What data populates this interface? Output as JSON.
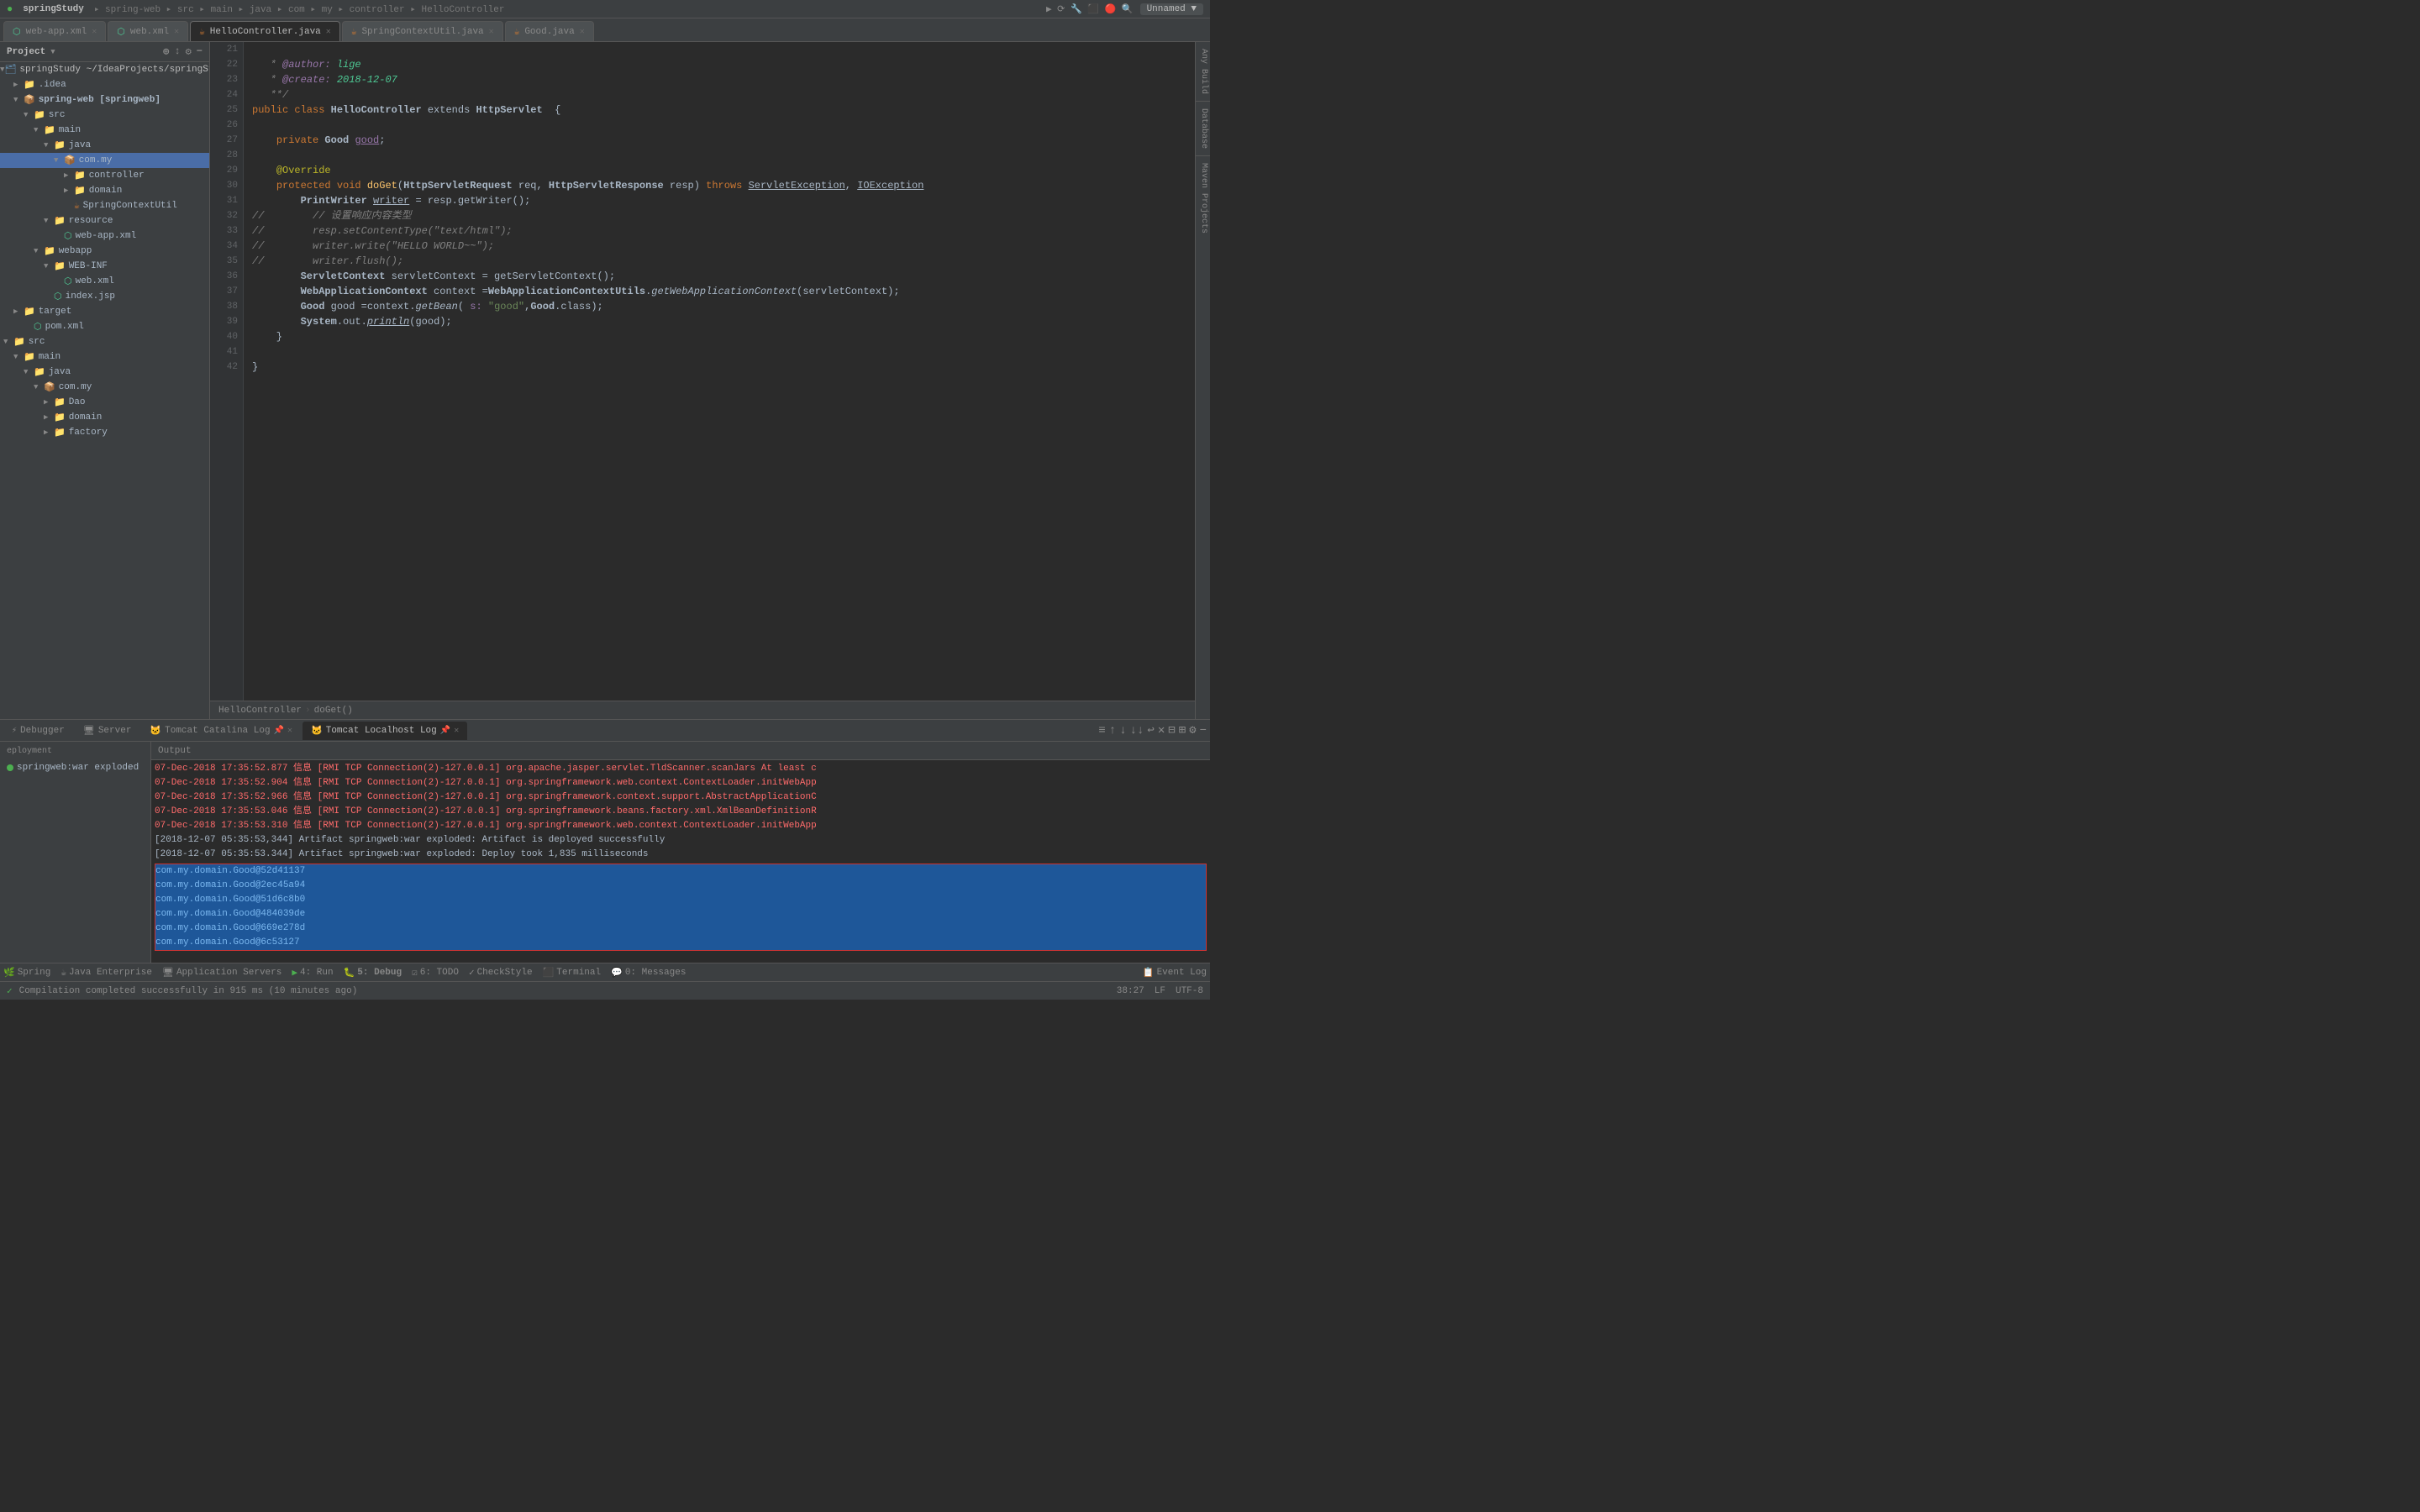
{
  "app": {
    "title": "springStudy",
    "project_label": "Project"
  },
  "titlebar": {
    "breadcrumbs": [
      "springStudy",
      "spring-web",
      "src",
      "main",
      "java",
      "com",
      "my",
      "controller",
      "HelloController"
    ]
  },
  "tabs": [
    {
      "label": "web-app.xml",
      "active": false,
      "closable": true
    },
    {
      "label": "web.xml",
      "active": false,
      "closable": true
    },
    {
      "label": "HelloController.java",
      "active": true,
      "closable": true
    },
    {
      "label": "SpringContextUtil.java",
      "active": false,
      "closable": true
    },
    {
      "label": "Good.java",
      "active": false,
      "closable": true
    }
  ],
  "sidebar": {
    "project_label": "Project",
    "tree": [
      {
        "level": 0,
        "type": "project",
        "label": "springStudy ~/IdeaProjects/springStudy",
        "icon": "project",
        "expanded": true
      },
      {
        "level": 1,
        "type": "folder",
        "label": ".idea",
        "icon": "folder",
        "expanded": false
      },
      {
        "level": 1,
        "type": "module",
        "label": "spring-web [springweb]",
        "icon": "module",
        "expanded": true
      },
      {
        "level": 2,
        "type": "folder",
        "label": "src",
        "icon": "folder",
        "expanded": true
      },
      {
        "level": 3,
        "type": "folder",
        "label": "main",
        "icon": "folder",
        "expanded": true
      },
      {
        "level": 4,
        "type": "folder",
        "label": "java",
        "icon": "folder",
        "expanded": true
      },
      {
        "level": 5,
        "type": "package",
        "label": "com.my",
        "icon": "package",
        "expanded": true,
        "selected": true
      },
      {
        "level": 6,
        "type": "folder",
        "label": "controller",
        "icon": "folder",
        "expanded": false
      },
      {
        "level": 6,
        "type": "folder",
        "label": "domain",
        "icon": "folder",
        "expanded": false
      },
      {
        "level": 6,
        "type": "java",
        "label": "SpringContextUtil",
        "icon": "java",
        "expanded": false
      },
      {
        "level": 4,
        "type": "folder",
        "label": "resource",
        "icon": "folder",
        "expanded": true
      },
      {
        "level": 5,
        "type": "xml",
        "label": "web-app.xml",
        "icon": "xml"
      },
      {
        "level": 3,
        "type": "folder",
        "label": "webapp",
        "icon": "folder",
        "expanded": true
      },
      {
        "level": 4,
        "type": "folder",
        "label": "WEB-INF",
        "icon": "folder",
        "expanded": true
      },
      {
        "level": 5,
        "type": "xml",
        "label": "web.xml",
        "icon": "xml"
      },
      {
        "level": 4,
        "type": "jsp",
        "label": "index.jsp",
        "icon": "jsp"
      },
      {
        "level": 1,
        "type": "folder",
        "label": "target",
        "icon": "folder",
        "expanded": false
      },
      {
        "level": 1,
        "type": "xml",
        "label": "pom.xml",
        "icon": "xml"
      },
      {
        "level": 0,
        "type": "folder",
        "label": "src",
        "icon": "folder",
        "expanded": true
      },
      {
        "level": 1,
        "type": "folder",
        "label": "main",
        "icon": "folder",
        "expanded": true
      },
      {
        "level": 2,
        "type": "folder",
        "label": "java",
        "icon": "folder",
        "expanded": true
      },
      {
        "level": 3,
        "type": "package",
        "label": "com.my",
        "icon": "package",
        "expanded": true
      },
      {
        "level": 4,
        "type": "folder",
        "label": "Dao",
        "icon": "folder",
        "expanded": false
      },
      {
        "level": 4,
        "type": "folder",
        "label": "domain",
        "icon": "folder",
        "expanded": false
      },
      {
        "level": 4,
        "type": "folder",
        "label": "factory",
        "icon": "folder",
        "expanded": false
      }
    ]
  },
  "code": {
    "lines": [
      {
        "num": 21,
        "content": "   * @author: lige"
      },
      {
        "num": 22,
        "content": "   * @create: 2018-12-07"
      },
      {
        "num": 23,
        "content": "   **/"
      },
      {
        "num": 24,
        "content": "public class HelloController extends HttpServlet  {"
      },
      {
        "num": 25,
        "content": ""
      },
      {
        "num": 26,
        "content": "    private Good good;"
      },
      {
        "num": 27,
        "content": ""
      },
      {
        "num": 28,
        "content": "    @Override"
      },
      {
        "num": 29,
        "content": "    protected void doGet(HttpServletRequest req, HttpServletResponse resp) throws ServletException, IOException"
      },
      {
        "num": 30,
        "content": "        PrintWriter writer = resp.getWriter();"
      },
      {
        "num": 31,
        "content": "//        // 设置响应内容类型"
      },
      {
        "num": 32,
        "content": "//        resp.setContentType(\"text/html\");"
      },
      {
        "num": 33,
        "content": "//        writer.write(\"HELLO WORLD~~\");"
      },
      {
        "num": 34,
        "content": "//        writer.flush();"
      },
      {
        "num": 35,
        "content": "        ServletContext servletContext = getServletContext();"
      },
      {
        "num": 36,
        "content": "        WebApplicationContext context =WebApplicationContextUtils.getWebApplicationContext(servletContext);"
      },
      {
        "num": 37,
        "content": "        Good good =context.getBean( s: \"good\",Good.class);"
      },
      {
        "num": 38,
        "content": "        System.out.println(good);"
      },
      {
        "num": 39,
        "content": "    }"
      },
      {
        "num": 40,
        "content": ""
      },
      {
        "num": 41,
        "content": "}"
      },
      {
        "num": 42,
        "content": ""
      }
    ]
  },
  "breadcrumb": {
    "items": [
      "HelloController",
      "doGet()"
    ]
  },
  "bottom_tabs": [
    {
      "label": "Debugger",
      "active": false
    },
    {
      "label": "Server",
      "active": false
    },
    {
      "label": "Tomcat Catalina Log",
      "active": false
    },
    {
      "label": "Tomcat Localhost Log",
      "active": true
    }
  ],
  "deploy": {
    "header": "eployment",
    "item": "springweb:war exploded",
    "output_label": "Output"
  },
  "log_lines": [
    {
      "text": "07-Dec-2018 17:35:52.877 信息 [RMI TCP Connection(2)-127.0.0.1] org.apache.jasper.servlet.TldScanner.scanJars At least c",
      "type": "red"
    },
    {
      "text": "07-Dec-2018 17:35:52.904 信息 [RMI TCP Connection(2)-127.0.0.1] org.springframework.web.context.ContextLoader.initWebApp",
      "type": "red"
    },
    {
      "text": "07-Dec-2018 17:35:52.966 信息 [RMI TCP Connection(2)-127.0.0.1] org.springframework.context.support.AbstractApplicationC",
      "type": "red"
    },
    {
      "text": "07-Dec-2018 17:35:53.046 信息 [RMI TCP Connection(2)-127.0.0.1] org.springframework.beans.factory.xml.XmlBeanDefinitionR",
      "type": "red"
    },
    {
      "text": "07-Dec-2018 17:35:53.310 信息 [RMI TCP Connection(2)-127.0.0.1] org.springframework.web.context.ContextLoader.initWebApp",
      "type": "red"
    },
    {
      "text": "[2018-12-07 05:35:53,344] Artifact springweb:war exploded: Artifact is deployed successfully",
      "type": "normal"
    },
    {
      "text": "[2018-12-07 05:35:53.344] Artifact springweb:war exploded: Deploy took 1,835 milliseconds",
      "type": "normal"
    }
  ],
  "selected_log": [
    "com.my.domain.Good@52d41137",
    "com.my.domain.Good@2ec45a94",
    "com.my.domain.Good@51d6c8b0",
    "com.my.domain.Good@484039de",
    "com.my.domain.Good@669e278d",
    "com.my.domain.Good@6c53127"
  ],
  "status_bar": {
    "left_text": "Compilation completed successfully in 915 ms (10 minutes ago)",
    "spring": "Spring",
    "java_enterprise": "Java Enterprise",
    "app_servers": "Application Servers",
    "run_label": "4: Run",
    "debug_label": "5: Debug",
    "todo_label": "6: TODO",
    "checkstyle": "CheckStyle",
    "terminal": "Terminal",
    "messages": "0: Messages",
    "event_log": "Event Log",
    "time": "38:27",
    "encoding": "UTF-8"
  },
  "right_panel_labels": [
    "Any Build",
    "Database",
    "Maven Projects"
  ]
}
